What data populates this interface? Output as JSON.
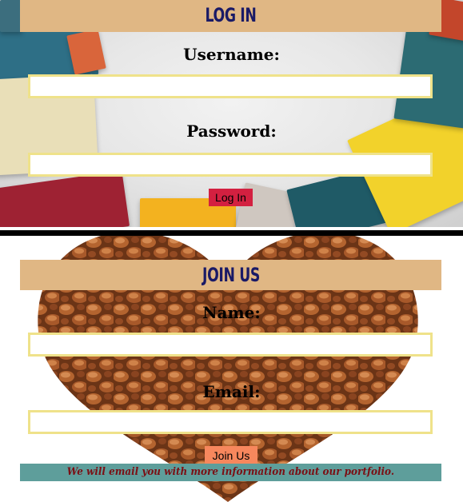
{
  "login": {
    "title": "LOG IN",
    "username_label": "Username:",
    "username_value": "",
    "password_label": "Password:",
    "password_value": "",
    "button_label": "Log In",
    "button_color": "#d32040"
  },
  "join": {
    "title": "JOIN US",
    "name_label": "Name:",
    "name_value": "",
    "email_label": "Email:",
    "email_value": "",
    "button_label": "Join Us",
    "button_color": "#f7875d",
    "notice": "We will email you with more information about our portfolio."
  },
  "colors": {
    "banner": "#e0b784",
    "banner_text": "#1a1a66",
    "input_border": "#efe28a",
    "notice_background": "#5e9e9b",
    "notice_text": "#7b0f14"
  },
  "images": {
    "login_background": "books-on-table",
    "join_background": "chocolate-chips-heart"
  }
}
